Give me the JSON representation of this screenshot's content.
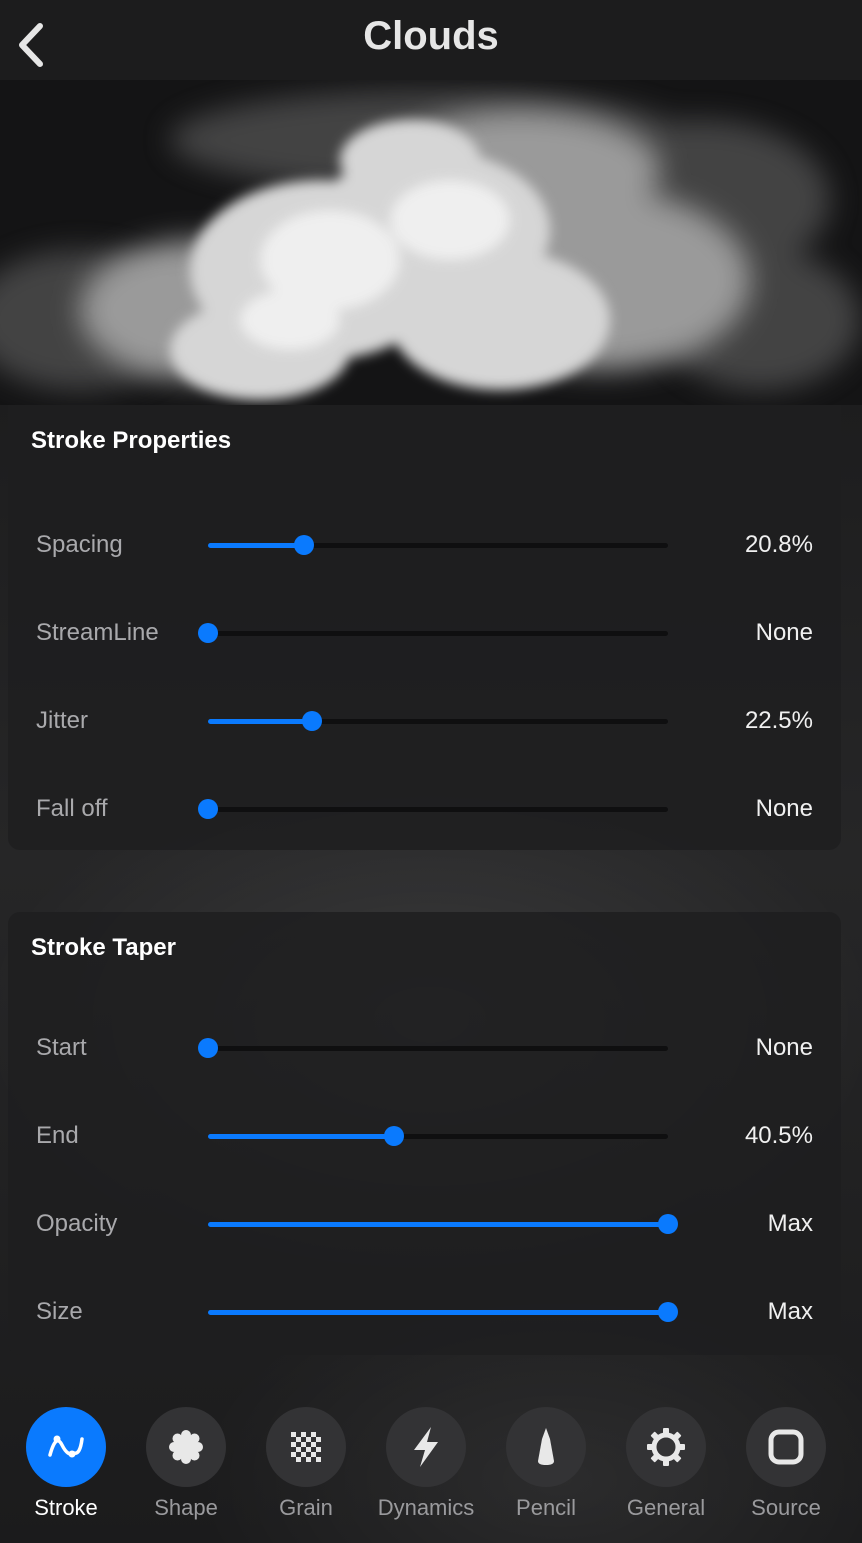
{
  "header": {
    "title": "Clouds"
  },
  "stroke_properties": {
    "title": "Stroke Properties",
    "rows": [
      {
        "label": "Spacing",
        "value": "20.8%",
        "level": 0.208
      },
      {
        "label": "StreamLine",
        "value": "None",
        "level": 0
      },
      {
        "label": "Jitter",
        "value": "22.5%",
        "level": 0.225
      },
      {
        "label": "Fall off",
        "value": "None",
        "level": 0
      }
    ]
  },
  "stroke_taper": {
    "title": "Stroke Taper",
    "rows": [
      {
        "label": "Start",
        "value": "None",
        "level": 0
      },
      {
        "label": "End",
        "value": "40.5%",
        "level": 0.405
      },
      {
        "label": "Opacity",
        "value": "Max",
        "level": 1
      },
      {
        "label": "Size",
        "value": "Max",
        "level": 1
      }
    ]
  },
  "tabs": [
    {
      "label": "Stroke",
      "icon": "stroke-path-icon",
      "active": true
    },
    {
      "label": "Shape",
      "icon": "shape-icon",
      "active": false
    },
    {
      "label": "Grain",
      "icon": "grain-icon",
      "active": false
    },
    {
      "label": "Dynamics",
      "icon": "lightning-icon",
      "active": false
    },
    {
      "label": "Pencil",
      "icon": "pencil-icon",
      "active": false
    },
    {
      "label": "General",
      "icon": "gear-icon",
      "active": false
    },
    {
      "label": "Source",
      "icon": "source-square-icon",
      "active": false
    }
  ],
  "colors": {
    "accent": "#0a7afe",
    "background": "#1c1c1d"
  }
}
